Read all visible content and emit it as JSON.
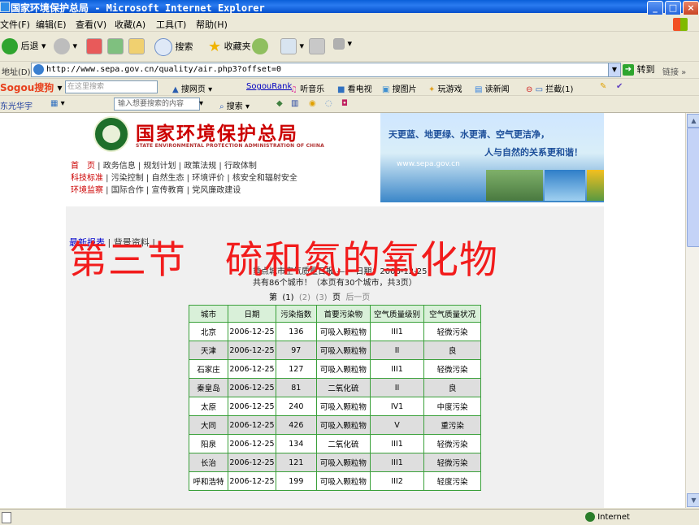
{
  "window": {
    "title": "国家环境保护总局 - Microsoft Internet Explorer",
    "controls": [
      "_",
      "□",
      "×"
    ]
  },
  "menu": [
    "文件(F)",
    "编辑(E)",
    "查看(V)",
    "收藏(A)",
    "工具(T)",
    "帮助(H)"
  ],
  "toolbar": {
    "back": "后退",
    "search": "搜索",
    "favorites": "收藏夹"
  },
  "address": {
    "label": "地址(D)",
    "url": "http://www.sepa.gov.cn/quality/air.php3?offset=0",
    "go": "转到",
    "links": "链接 »"
  },
  "sogou": {
    "logo": "Sogou搜狗",
    "placeholder": "在这里搜索",
    "items": [
      "搜网页",
      "SogouRank",
      "听音乐",
      "看电视",
      "搜图片",
      "玩游戏",
      "读新闻",
      "拦截(1)"
    ]
  },
  "bar3": {
    "name": "东光华宇",
    "input_placeholder": "输入想要搜索的内容",
    "search": "搜索"
  },
  "site": {
    "name": "国家环境保护总局",
    "name_en": "STATE ENVIRONMENTAL PROTECTION ADMINISTRATION OF CHINA",
    "nav_lines": [
      [
        "首　页",
        "政务信息",
        "规划计划",
        "政策法规",
        "行政体制"
      ],
      [
        "科技标准",
        "污染控制",
        "自然生态",
        "环境评价",
        "核安全和辐射安全"
      ],
      [
        "环境监察",
        "国际合作",
        "宣传教育",
        "党风廉政建设"
      ]
    ],
    "banner_slogan_1": "天更蓝、地更绿、水更清、空气更洁净，",
    "banner_slogan_2": "人与自然的关系更和谐！",
    "banner_url": "www.sepa.gov.cn"
  },
  "breadcrumb": {
    "a": "最新报表",
    "b": "背景资料"
  },
  "overlay_title": "第三节　硫和氮的氧化物",
  "report": {
    "title": "重点城市空气质量日报 —— 日期：2006-12-25",
    "count": "共有86个城市！（本页有30个城市，共3页）",
    "pager": [
      "第",
      "(1)",
      "(2)",
      "(3)",
      "页",
      "后一页"
    ]
  },
  "table": {
    "headers": [
      "城市",
      "日期",
      "污染指数",
      "首要污染物",
      "空气质量级别",
      "空气质量状况"
    ],
    "rows": [
      [
        "北京",
        "2006-12-25",
        "136",
        "可吸入颗粒物",
        "III1",
        "轻微污染"
      ],
      [
        "天津",
        "2006-12-25",
        "97",
        "可吸入颗粒物",
        "II",
        "良"
      ],
      [
        "石家庄",
        "2006-12-25",
        "127",
        "可吸入颗粒物",
        "III1",
        "轻微污染"
      ],
      [
        "秦皇岛",
        "2006-12-25",
        "81",
        "二氧化硫",
        "II",
        "良"
      ],
      [
        "太原",
        "2006-12-25",
        "240",
        "可吸入颗粒物",
        "IV1",
        "中度污染"
      ],
      [
        "大同",
        "2006-12-25",
        "426",
        "可吸入颗粒物",
        "V",
        "重污染"
      ],
      [
        "阳泉",
        "2006-12-25",
        "134",
        "二氧化硫",
        "III1",
        "轻微污染"
      ],
      [
        "长治",
        "2006-12-25",
        "121",
        "可吸入颗粒物",
        "III1",
        "轻微污染"
      ],
      [
        "呼和浩特",
        "2006-12-25",
        "199",
        "可吸入颗粒物",
        "III2",
        "轻度污染"
      ]
    ]
  },
  "status": {
    "zone": "Internet"
  },
  "colors": {
    "titlebar": "#0a5fd8",
    "site_red": "#cc0000",
    "overlay_red": "#f21c1c",
    "table_border": "#3aa03a"
  }
}
